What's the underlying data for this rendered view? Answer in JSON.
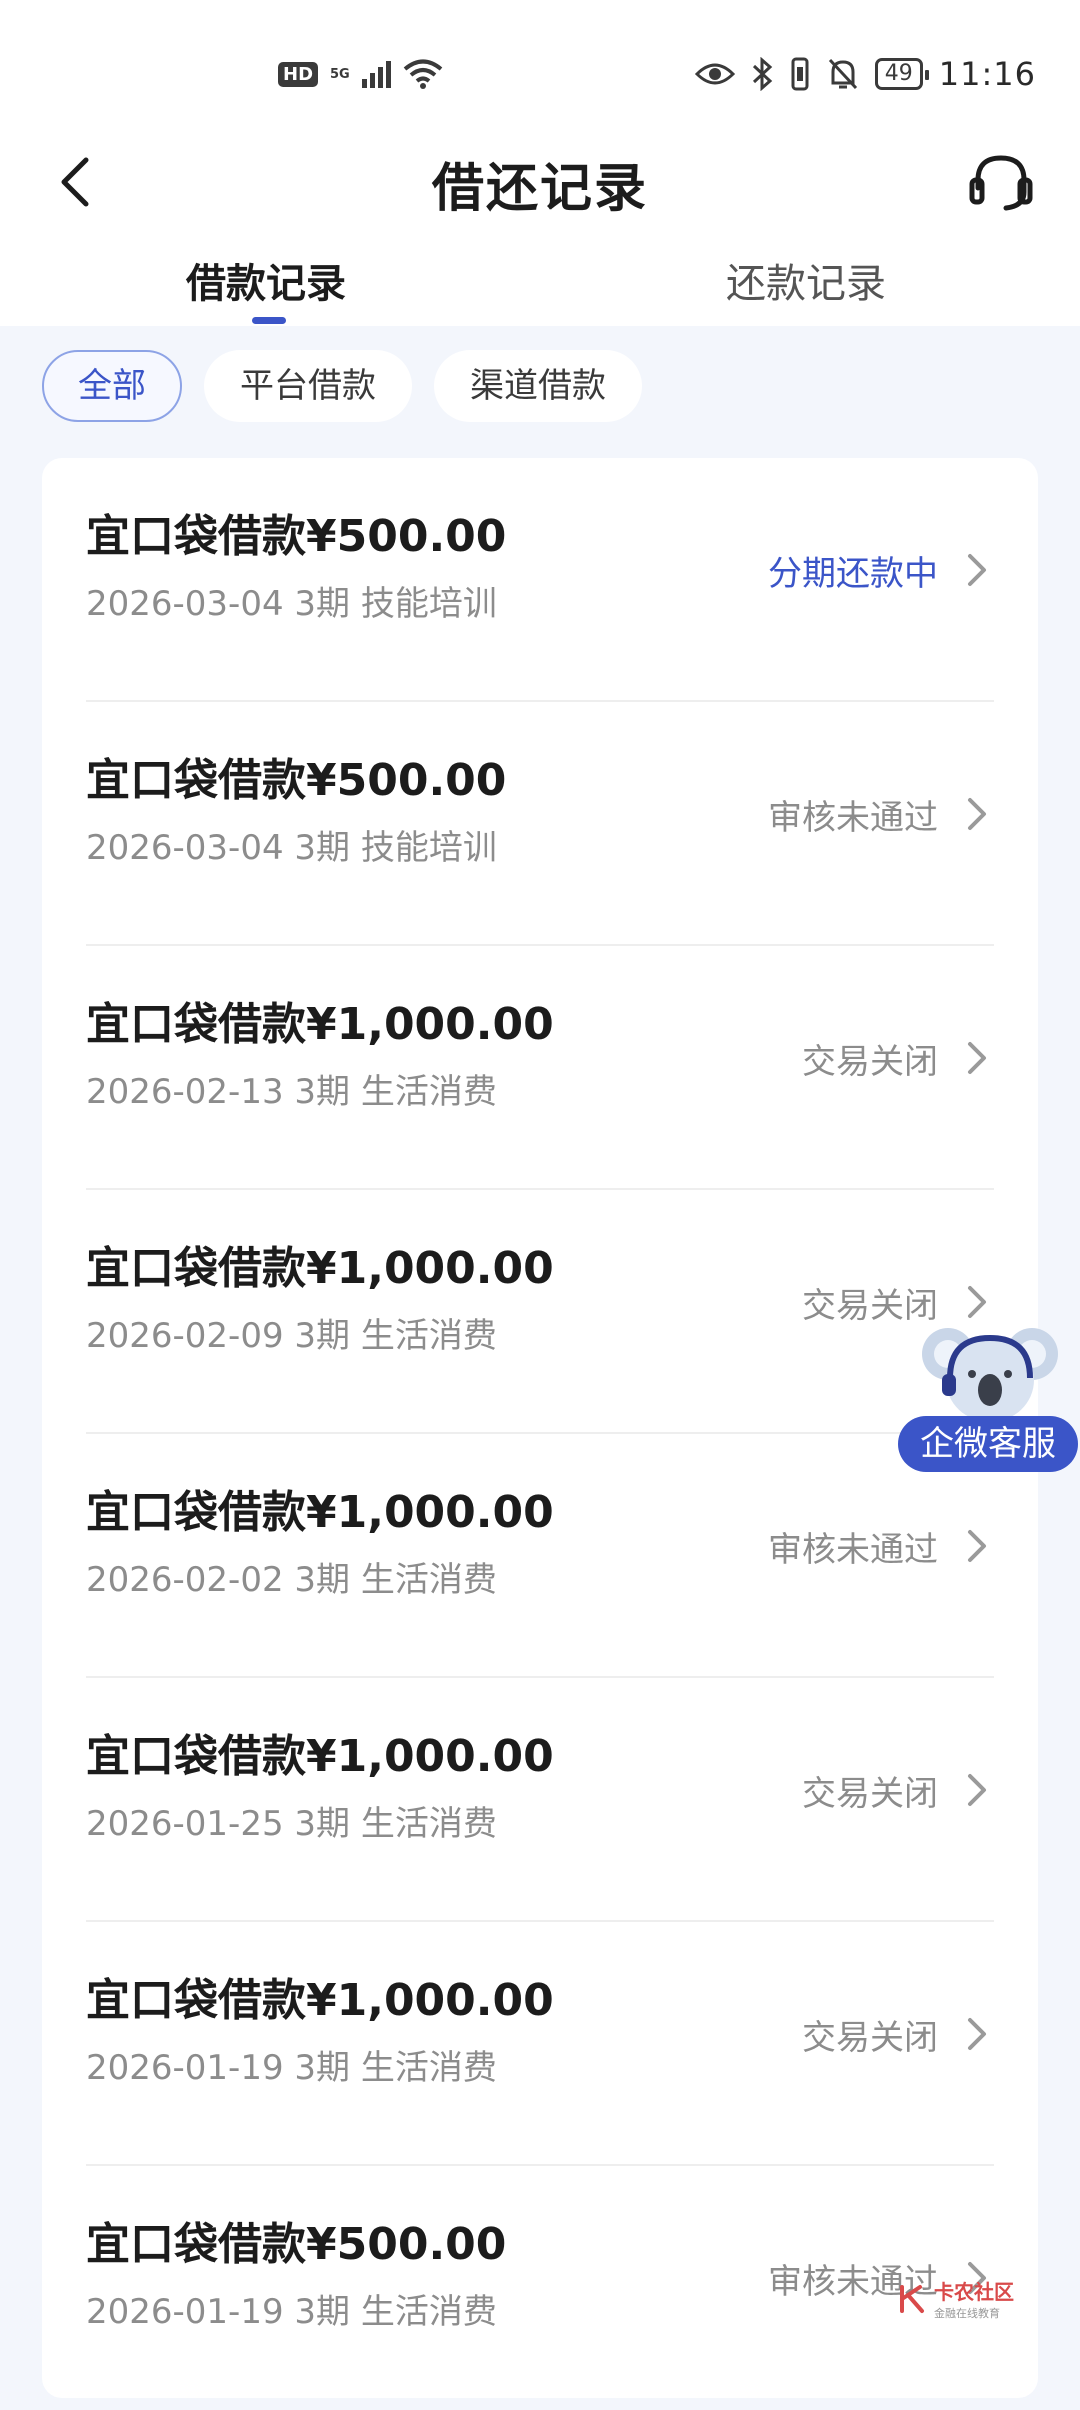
{
  "status_bar": {
    "hd": "HD",
    "network": "5G",
    "battery": "49",
    "time": "11:16"
  },
  "header": {
    "title": "借还记录"
  },
  "tabs": [
    {
      "label": "借款记录",
      "active": true
    },
    {
      "label": "还款记录",
      "active": false
    }
  ],
  "filters": [
    {
      "label": "全部",
      "active": true
    },
    {
      "label": "平台借款",
      "active": false
    },
    {
      "label": "渠道借款",
      "active": false
    }
  ],
  "records": [
    {
      "amount": "宜口袋借款¥500.00",
      "meta": "2026-03-04 3期  技能培训",
      "status": "分期还款中",
      "status_color": "#3b55c8"
    },
    {
      "amount": "宜口袋借款¥500.00",
      "meta": "2026-03-04 3期  技能培训",
      "status": "审核未通过",
      "status_color": "#8c8c8c"
    },
    {
      "amount": "宜口袋借款¥1,000.00",
      "meta": "2026-02-13 3期  生活消费",
      "status": "交易关闭",
      "status_color": "#8c8c8c"
    },
    {
      "amount": "宜口袋借款¥1,000.00",
      "meta": "2026-02-09 3期  生活消费",
      "status": "交易关闭",
      "status_color": "#8c8c8c"
    },
    {
      "amount": "宜口袋借款¥1,000.00",
      "meta": "2026-02-02 3期  生活消费",
      "status": "审核未通过",
      "status_color": "#8c8c8c"
    },
    {
      "amount": "宜口袋借款¥1,000.00",
      "meta": "2026-01-25 3期  生活消费",
      "status": "交易关闭",
      "status_color": "#8c8c8c"
    },
    {
      "amount": "宜口袋借款¥1,000.00",
      "meta": "2026-01-19 3期  生活消费",
      "status": "交易关闭",
      "status_color": "#8c8c8c"
    },
    {
      "amount": "宜口袋借款¥500.00",
      "meta": "2026-01-19 3期  生活消费",
      "status": "审核未通过",
      "status_color": "#8c8c8c"
    }
  ],
  "floating_service": {
    "label": "企微客服"
  },
  "watermark": {
    "main": "卡农社区",
    "sub": "金融在线教育"
  },
  "colors": {
    "accent": "#3b55c8",
    "page_background": "#f3f6fc",
    "muted_text": "#8c8c8c"
  },
  "icons": {
    "back": "chevron-left-icon",
    "customer_service": "headset-icon",
    "row_arrow": "chevron-right-icon"
  }
}
